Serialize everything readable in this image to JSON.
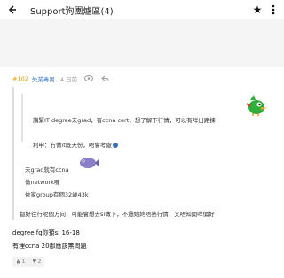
{
  "header": {
    "back_icon": "arrow-left-icon",
    "title": "Support狗團爐區(4)",
    "star_icon": "star-icon",
    "menu_icon": "more-vertical-icon"
  },
  "post": {
    "floor": "#102",
    "username": "失業毒男",
    "time": "4 日前",
    "quote_lines": [
      "講緊IT degree未grad，有ccna cert，想了解下行情，可以有咩出路揀",
      "利申：冇做it既天份，唔會考慮"
    ],
    "body_lines": [
      "未grad就有ccna",
      "做network囉",
      "依家group有個32歲43k",
      "都好往行呢個方向，可能會想去si做下，不過始終唔熟行情，又唔知開咩價好"
    ],
    "reply_lines": [
      "degree fg你預si 16-18",
      "有埋ccna 20都應該無問題"
    ],
    "votes": {
      "up_icon": "thumb-up-icon",
      "up_count": "1",
      "down_icon": "thumb-down-icon",
      "down_count": "2"
    }
  },
  "colors": {
    "floor": "#e0a000",
    "username": "#3b7bc8",
    "banner_bg": "#f5f5f5"
  }
}
